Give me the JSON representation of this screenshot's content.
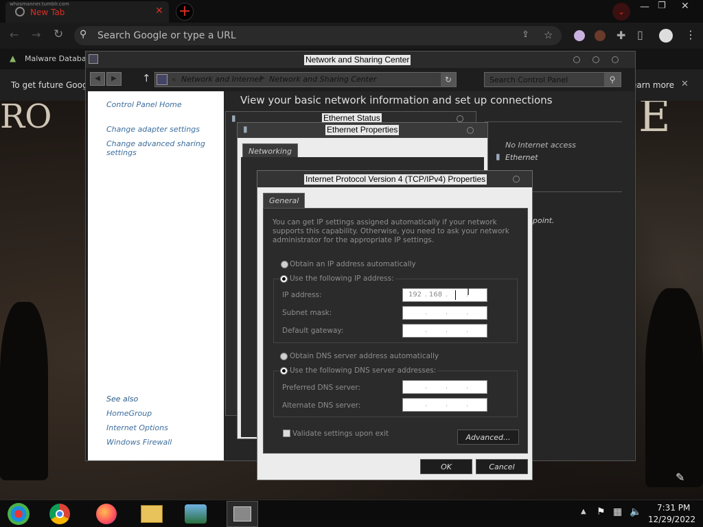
{
  "browser": {
    "tab_title": "New Tab",
    "tab_subtitle": "whosmanner.tumblr.com",
    "omnibox_placeholder": "Search Google or type a URL",
    "bookmark": "Malware Databa",
    "infobar_left": "To get future Goog",
    "infobar_right": "earn more"
  },
  "nsc": {
    "title": "Network and Sharing Center",
    "breadcrumb": [
      "Network and Internet",
      "Network and Sharing Center"
    ],
    "search_placeholder": "Search Control Panel",
    "heading": "View your basic network information and set up connections",
    "left_links": [
      "Control Panel Home",
      "Change adapter settings",
      "Change advanced sharing settings"
    ],
    "see_also_title": "See also",
    "see_also": [
      "HomeGroup",
      "Internet Options",
      "Windows Firewall"
    ],
    "access_type": "No Internet access",
    "connection": "Ethernet",
    "partial_text": "point."
  },
  "eth_status": {
    "title": "Ethernet Status"
  },
  "eth_props": {
    "title": "Ethernet Properties",
    "tab": "Networking"
  },
  "ipv4": {
    "title": "Internet Protocol Version 4 (TCP/IPv4) Properties",
    "tab": "General",
    "description": "You can get IP settings assigned automatically if your network supports this capability. Otherwise, you need to ask your network administrator for the appropriate IP settings.",
    "radio_auto_ip": "Obtain an IP address automatically",
    "radio_manual_ip": "Use the following IP address:",
    "ip_label": "IP address:",
    "ip_oct1": "192",
    "ip_oct2": "168",
    "subnet_label": "Subnet mask:",
    "gateway_label": "Default gateway:",
    "radio_auto_dns": "Obtain DNS server address automatically",
    "radio_manual_dns": "Use the following DNS server addresses:",
    "pref_dns_label": "Preferred DNS server:",
    "alt_dns_label": "Alternate DNS server:",
    "validate_label": "Validate settings upon exit",
    "advanced_button": "Advanced...",
    "ok_button": "OK",
    "cancel_button": "Cancel"
  },
  "taskbar": {
    "time": "7:31 PM",
    "date": "12/29/2022"
  },
  "colors": {
    "accent": "#d93025",
    "link": "#3b6d9e"
  }
}
